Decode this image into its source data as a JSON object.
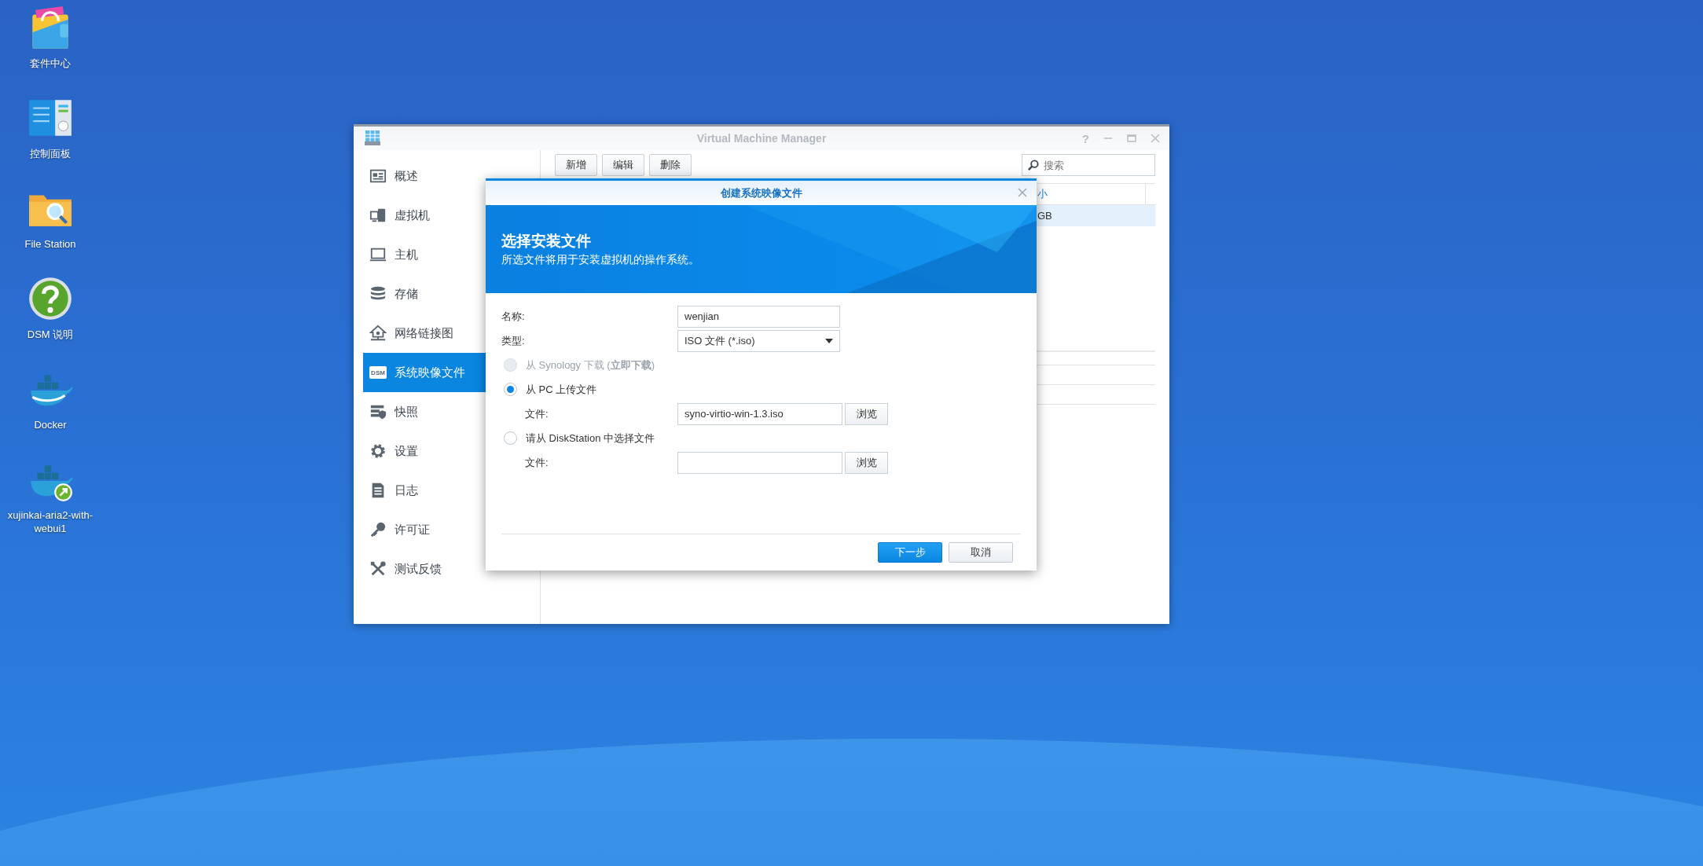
{
  "desktop": {
    "icons": [
      {
        "label": "套件中心"
      },
      {
        "label": "控制面板"
      },
      {
        "label": "File Station"
      },
      {
        "label": "DSM 说明"
      },
      {
        "label": "Docker"
      },
      {
        "label": "xujinkai-aria2-with-webui1"
      }
    ]
  },
  "window": {
    "title": "Virtual Machine Manager",
    "help_glyph": "?"
  },
  "sidebar": {
    "items": [
      {
        "label": "概述",
        "selected": false
      },
      {
        "label": "虚拟机",
        "selected": false
      },
      {
        "label": "主机",
        "selected": false
      },
      {
        "label": "存储",
        "selected": false
      },
      {
        "label": "网络链接图",
        "selected": false
      },
      {
        "label": "系统映像文件",
        "selected": true,
        "icon_text": "DSM"
      },
      {
        "label": "快照",
        "selected": false
      },
      {
        "label": "设置",
        "selected": false
      },
      {
        "label": "日志",
        "selected": false
      },
      {
        "label": "许可证",
        "selected": false
      },
      {
        "label": "测试反馈",
        "selected": false
      }
    ]
  },
  "toolbar": {
    "buttons": [
      "新增",
      "编辑",
      "删除"
    ],
    "search": {
      "placeholder": "搜索"
    }
  },
  "table": {
    "columns": [
      {
        "label": "小"
      }
    ],
    "rows": [
      {
        "cells": [
          "GB"
        ],
        "selected": true
      }
    ]
  },
  "dialog": {
    "title": "创建系统映像文件",
    "heading": "选择安装文件",
    "subtitle": "所选文件将用于安装虚拟机的操作系统。",
    "name_field": {
      "label": "名称:",
      "value": "wenjian"
    },
    "type_field": {
      "label": "类型:",
      "value": "ISO 文件 (*.iso)"
    },
    "sources": [
      {
        "label": "从 Synology 下载 (**立即下载**)",
        "selected": false,
        "disabled": true
      },
      {
        "label": "从 PC 上传文件",
        "selected": true,
        "disabled": false,
        "file": {
          "label": "文件:",
          "value": "syno-virtio-win-1.3.iso",
          "button": "浏览"
        }
      },
      {
        "label": "请从 DiskStation 中选择文件",
        "selected": false,
        "disabled": false,
        "file": {
          "label": "文件:",
          "button": "浏览"
        }
      }
    ],
    "buttons": [
      {
        "label": "下一步",
        "kind": "primary"
      },
      {
        "label": "取消",
        "kind": "secondary"
      }
    ]
  }
}
